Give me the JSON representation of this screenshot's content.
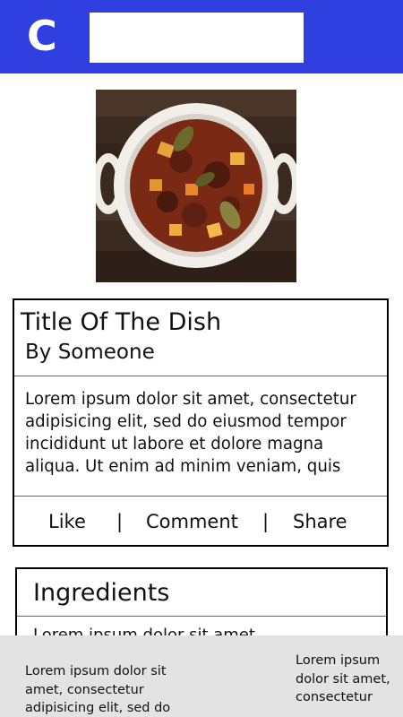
{
  "header": {
    "logo_letter": "C",
    "search_value": "",
    "colors": {
      "bar": "#2f3fe0",
      "logo": "#ffffff"
    }
  },
  "dish": {
    "image_icon": "food-photo-icon",
    "title": "Title Of The Dish",
    "author": "By Someone",
    "description": "Lorem ipsum dolor sit amet, consectetur adipisicing elit, sed do eiusmod tempor incididunt ut labore et dolore magna aliqua. Ut enim ad minim veniam, quis"
  },
  "actions": {
    "like": "Like",
    "separator": "|",
    "comment": "Comment",
    "share": "Share"
  },
  "ingredients": {
    "title": "Ingredients",
    "first_item": "Lorem ipsum dolor sit amet"
  },
  "bottom_panel": {
    "left_text": "Lorem ipsum dolor sit amet, consectetur adipisicing elit, sed do",
    "right_text": "Lorem ipsum dolor sit amet, consectetur"
  }
}
